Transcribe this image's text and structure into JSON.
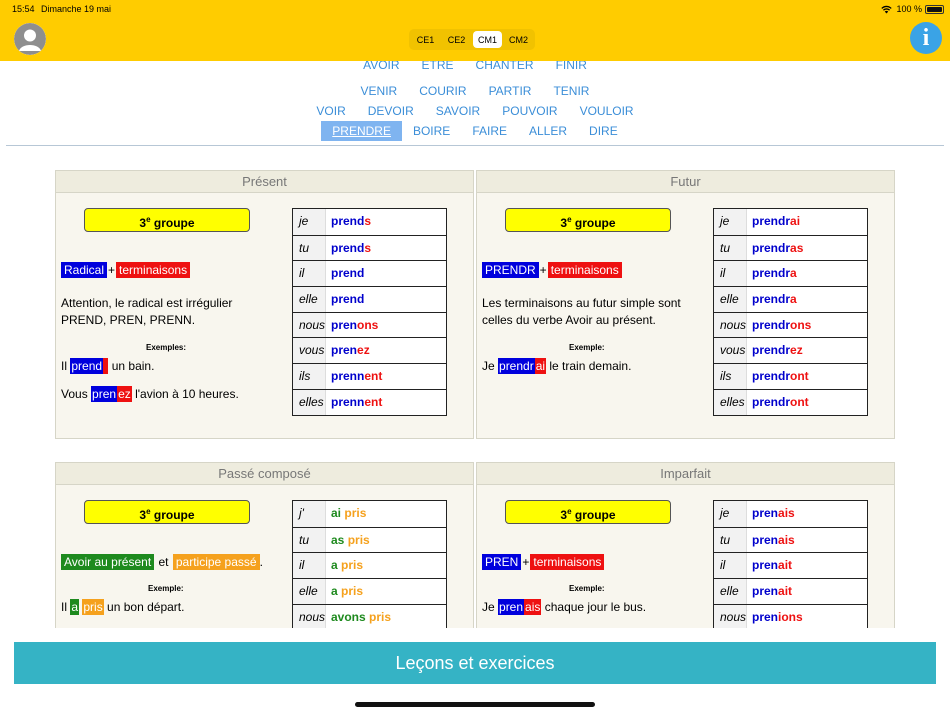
{
  "status": {
    "time": "15:54",
    "date": "Dimanche 19 mai",
    "battery": "100 %"
  },
  "levels": {
    "items": [
      "CE1",
      "CE2",
      "CM1",
      "CM2"
    ],
    "selected": "CM1"
  },
  "verbs": {
    "row0": [
      "AVOIR",
      "ÊTRE",
      "CHANTER",
      "FINIR"
    ],
    "row1": [
      "VENIR",
      "COURIR",
      "PARTIR",
      "TENIR"
    ],
    "row2": [
      "VOIR",
      "DEVOIR",
      "SAVOIR",
      "POUVOIR",
      "VOULOIR"
    ],
    "row3": [
      "PRENDRE",
      "BOIRE",
      "FAIRE",
      "ALLER",
      "DIRE"
    ],
    "selected": "PRENDRE"
  },
  "present": {
    "title": "Présent",
    "groupe": "3",
    "groupe_sup": "e",
    "groupe_word": " groupe",
    "tag1": "Radical",
    "plus": "+",
    "tag2": "terminaisons",
    "text": "Attention, le radical est irrégulier PREND, PREN, PRENN.",
    "ex_label": "Exemples:",
    "ex1_a": "Il ",
    "ex1_h1": "prend",
    "ex1_h2": " ",
    "ex1_b": " un bain.",
    "ex2_a": "Vous ",
    "ex2_h1": "pren",
    "ex2_h2": "ez",
    "ex2_b": " l'avion à 10 heures.",
    "rows": [
      {
        "pron": "je",
        "stem": "prend",
        "end": "s"
      },
      {
        "pron": "tu",
        "stem": "prend",
        "end": "s"
      },
      {
        "pron": "il",
        "stem": "prend",
        "end": ""
      },
      {
        "pron": "elle",
        "stem": "prend",
        "end": ""
      },
      {
        "pron": "nous",
        "stem": "pren",
        "end": "ons"
      },
      {
        "pron": "vous",
        "stem": "pren",
        "end": "ez"
      },
      {
        "pron": "ils",
        "stem": "prenn",
        "end": "ent"
      },
      {
        "pron": "elles",
        "stem": "prenn",
        "end": "ent"
      }
    ]
  },
  "futur": {
    "title": "Futur",
    "groupe": "3",
    "groupe_sup": "e",
    "groupe_word": " groupe",
    "tag1": "PRENDR",
    "plus": "+",
    "tag2": "terminaisons",
    "text": "Les terminaisons au futur simple sont celles du verbe Avoir au présent.",
    "ex_label": "Exemple:",
    "ex1_a": "Je ",
    "ex1_h1": "prendr",
    "ex1_h2": "ai",
    "ex1_b": " le train demain.",
    "rows": [
      {
        "pron": "je",
        "stem": "prendr",
        "end": "ai"
      },
      {
        "pron": "tu",
        "stem": "prendr",
        "end": "as"
      },
      {
        "pron": "il",
        "stem": "prendr",
        "end": "a"
      },
      {
        "pron": "elle",
        "stem": "prendr",
        "end": "a"
      },
      {
        "pron": "nous",
        "stem": "prendr",
        "end": "ons"
      },
      {
        "pron": "vous",
        "stem": "prendr",
        "end": "ez"
      },
      {
        "pron": "ils",
        "stem": "prendr",
        "end": "ont"
      },
      {
        "pron": "elles",
        "stem": "prendr",
        "end": "ont"
      }
    ]
  },
  "passe": {
    "title": "Passé composé",
    "groupe": "3",
    "groupe_sup": "e",
    "groupe_word": " groupe",
    "tag1": "Avoir au présent",
    "plus": " et ",
    "tag2": "participe passé",
    "tail": ".",
    "ex_label": "Exemple:",
    "ex1_a": "Il ",
    "ex1_h1": "a",
    "ex1_h2": "pris",
    "ex1_b": " un bon départ.",
    "rows": [
      {
        "pron": "j'",
        "aux": "ai",
        "part": "pris"
      },
      {
        "pron": "tu",
        "aux": "as",
        "part": "pris"
      },
      {
        "pron": "il",
        "aux": "a",
        "part": "pris"
      },
      {
        "pron": "elle",
        "aux": "a",
        "part": "pris"
      },
      {
        "pron": "nous",
        "aux": "avons",
        "part": "pris"
      }
    ]
  },
  "imparfait": {
    "title": "Imparfait",
    "groupe": "3",
    "groupe_sup": "e",
    "groupe_word": " groupe",
    "tag1": "PREN",
    "plus": "+",
    "tag2": "terminaisons",
    "ex_label": "Exemple:",
    "ex1_a": "Je ",
    "ex1_h1": "pren",
    "ex1_h2": "ais",
    "ex1_b": " chaque jour le bus.",
    "rows": [
      {
        "pron": "je",
        "stem": "pren",
        "end": "ais"
      },
      {
        "pron": "tu",
        "stem": "pren",
        "end": "ais"
      },
      {
        "pron": "il",
        "stem": "pren",
        "end": "ait"
      },
      {
        "pron": "elle",
        "stem": "pren",
        "end": "ait"
      },
      {
        "pron": "nous",
        "stem": "pren",
        "end": "ions"
      }
    ]
  },
  "bottom": {
    "lessons": "Leçons et exercices"
  },
  "colors": {
    "header": "#ffcc00",
    "accent": "#3b8ed8",
    "button": "#35b3c5",
    "stem": "#0000cc",
    "ending": "#ee1111"
  }
}
